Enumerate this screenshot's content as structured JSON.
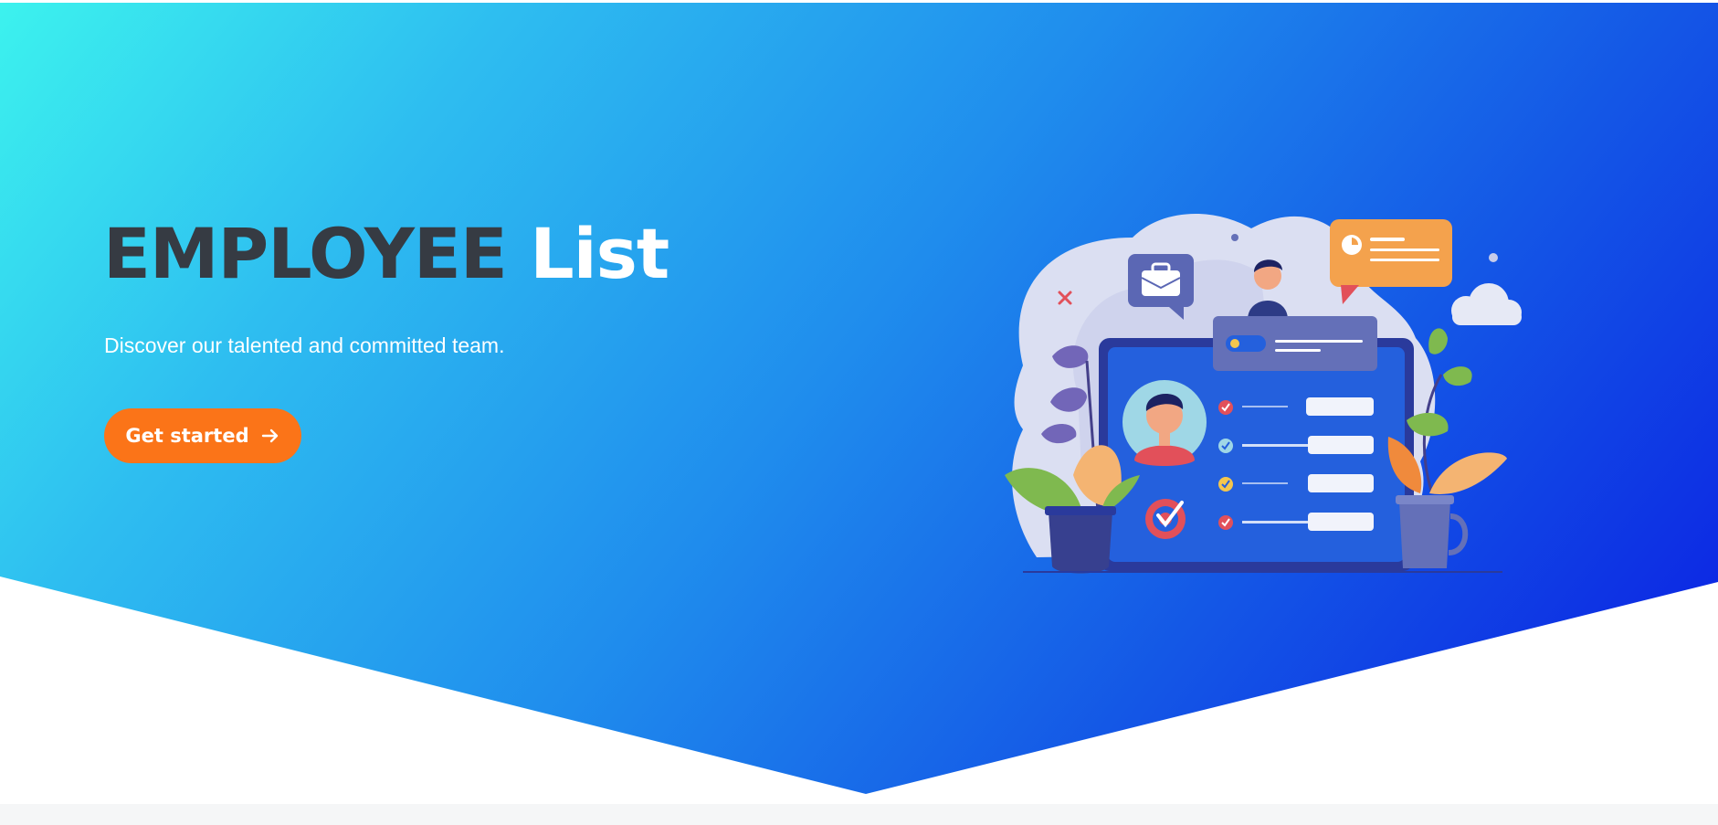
{
  "hero": {
    "title_strong": "EMPLOYEE",
    "title_light": "List",
    "subtitle": "Discover our talented and committed team.",
    "cta_label": "Get started",
    "cta_icon": "arrow-right-icon"
  },
  "illustration": {
    "icons": [
      "briefcase-icon",
      "chat-bubble-icon",
      "person-icon",
      "avatar-icon",
      "target-icon",
      "checkmark-icon",
      "cloud-icon",
      "plant-icon",
      "mug-icon"
    ]
  },
  "colors": {
    "gradient_start": "#3cf2ee",
    "gradient_end": "#0a1be3",
    "title_dark": "#363b43",
    "cta_orange": "#fb7418",
    "background": "#ffffff"
  }
}
